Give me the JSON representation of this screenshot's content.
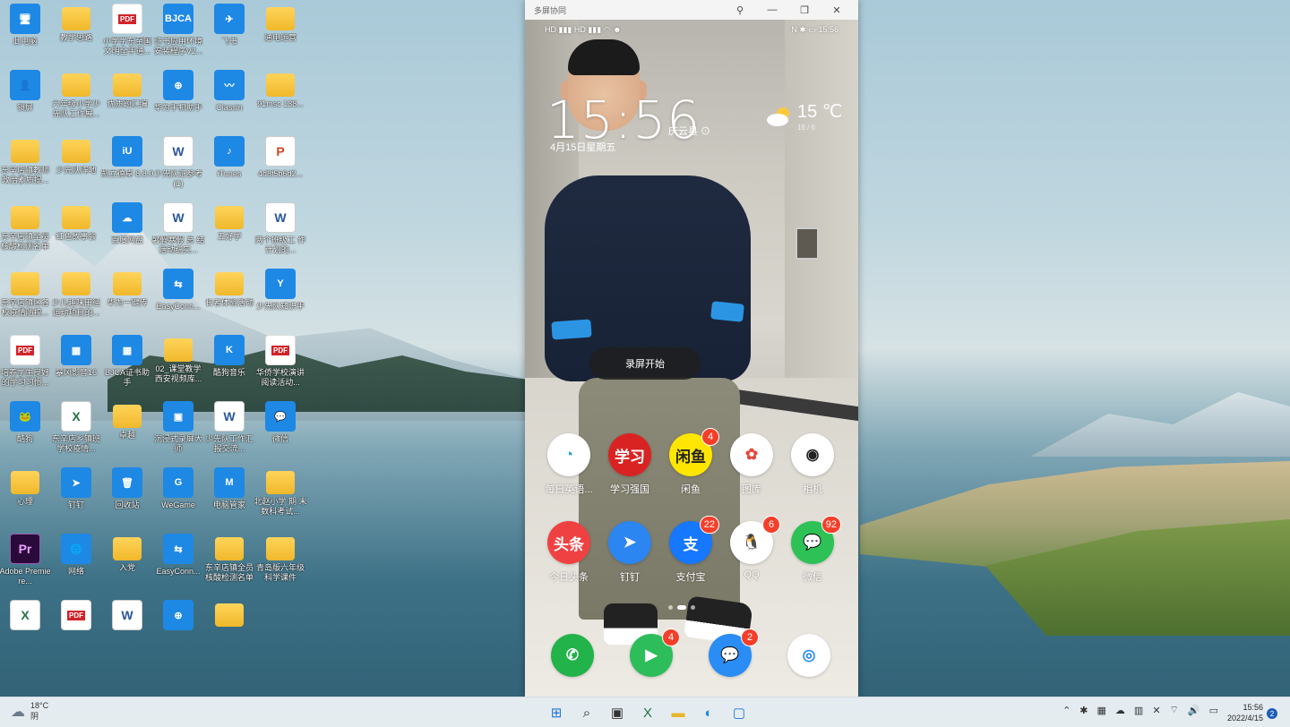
{
  "desktop": {
    "icons": [
      {
        "label": "此电脑",
        "glyph": "🖥"
      },
      {
        "label": "教学思路",
        "glyph": ""
      },
      {
        "label": "小学学东至国 文明全手通...",
        "glyph": "PDF"
      },
      {
        "label": "证书应用环境 安装程序V2...",
        "glyph": "BJCA"
      },
      {
        "label": "飞书",
        "glyph": "✈"
      },
      {
        "label": "通电运营",
        "glyph": ""
      },
      {
        "label": "锁屏",
        "glyph": "👤"
      },
      {
        "label": "六年级小学少 先队工作展...",
        "glyph": ""
      },
      {
        "label": "优质题汇编",
        "glyph": ""
      },
      {
        "label": "华为手机助手",
        "glyph": "⊕"
      },
      {
        "label": "Classin",
        "glyph": "〰"
      },
      {
        "label": "91msc 138...",
        "glyph": ""
      },
      {
        "label": "东辛店镇教师 政治素质提...",
        "glyph": ""
      },
      {
        "label": "少先队阵地",
        "glyph": ""
      },
      {
        "label": "凯立德卓 8.8.0",
        "glyph": "iU"
      },
      {
        "label": "少先队证参考 (1)",
        "glyph": "W"
      },
      {
        "label": "iTunes",
        "glyph": "♪"
      },
      {
        "label": "4d8f5b6d2...",
        "glyph": "P"
      },
      {
        "label": "东辛店镇全员 核酸检测名单",
        "glyph": ""
      },
      {
        "label": "红色故事会",
        "glyph": ""
      },
      {
        "label": "百度网盘",
        "glyph": "☁"
      },
      {
        "label": "暑假寒假 总 结活动纪实...",
        "glyph": "W"
      },
      {
        "label": "五好学",
        "glyph": ""
      },
      {
        "label": "两个班级工 作计划的...",
        "glyph": "W"
      },
      {
        "label": "东辛店镇区各 校疫情防控...",
        "glyph": ""
      },
      {
        "label": "少儿趣味田径 运动项目的...",
        "glyph": ""
      },
      {
        "label": "华为一键传",
        "glyph": ""
      },
      {
        "label": "EasyConn...",
        "glyph": "⇆"
      },
      {
        "label": "长者体验活动",
        "glyph": ""
      },
      {
        "label": "少先队知识手",
        "glyph": "Y"
      },
      {
        "label": "培养学生良好 的学习习惯...",
        "glyph": "PDF"
      },
      {
        "label": "暴风影音16",
        "glyph": "▦"
      },
      {
        "label": "BJCA证书助 手",
        "glyph": "▦"
      },
      {
        "label": "02_课堂教学 西安视频库...",
        "glyph": ""
      },
      {
        "label": "酷狗音乐",
        "glyph": "K"
      },
      {
        "label": "华侨学校演讲 阅读活动...",
        "glyph": "PDF"
      },
      {
        "label": "酷狗",
        "glyph": "🐸"
      },
      {
        "label": "东辛店乡镇班 学校疫情...",
        "glyph": "X"
      },
      {
        "label": "卓越",
        "glyph": ""
      },
      {
        "label": "沉浸式录屏大 师",
        "glyph": "▣"
      },
      {
        "label": "少先队工作汇 报交流...",
        "glyph": "W"
      },
      {
        "label": "微信",
        "glyph": "💬"
      },
      {
        "label": "心理",
        "glyph": ""
      },
      {
        "label": "钉钉",
        "glyph": "➤"
      },
      {
        "label": "回收站",
        "glyph": "🗑"
      },
      {
        "label": "WeGame",
        "glyph": "G"
      },
      {
        "label": "电脑管家",
        "glyph": "M"
      },
      {
        "label": "北赵小学 期 末数科考试...",
        "glyph": ""
      },
      {
        "label": "Adobe Premiere...",
        "glyph": "Pr"
      },
      {
        "label": "网络",
        "glyph": "🌐"
      },
      {
        "label": "入党",
        "glyph": ""
      },
      {
        "label": "EasyConn...",
        "glyph": "⇆"
      },
      {
        "label": "东辛店镇全员 核酸检测名单",
        "glyph": ""
      },
      {
        "label": "青岛版六年级 科学课件",
        "glyph": ""
      },
      {
        "label": "",
        "glyph": "X"
      },
      {
        "label": "",
        "glyph": "PDF"
      },
      {
        "label": "",
        "glyph": "W"
      },
      {
        "label": "",
        "glyph": "⊕"
      },
      {
        "label": "",
        "glyph": ""
      }
    ]
  },
  "phone_window": {
    "title": "多屏协同",
    "controls": {
      "pin": "⚲",
      "minimize": "—",
      "restore": "❐",
      "close": "✕"
    },
    "status": {
      "left": "HD ▮▮▮ HD ▮▮▮ ◠ ☻",
      "right": "N ✱ ▭ 15:56"
    },
    "clock": "15:56",
    "location": "庆云县 ⊙",
    "date": "4月15日星期五",
    "weather": {
      "temp": "15 ℃",
      "range": "16 / 6"
    },
    "toast": "录屏开始",
    "apps": [
      {
        "label": "每日英语...",
        "glyph": "◔",
        "bg": "#ffffff",
        "fg": "#2b9de0",
        "badge": ""
      },
      {
        "label": "学习强国",
        "glyph": "学习",
        "bg": "#d92323",
        "fg": "#ffffff",
        "badge": ""
      },
      {
        "label": "闲鱼",
        "glyph": "闲鱼",
        "bg": "#ffe600",
        "fg": "#222222",
        "badge": "4"
      },
      {
        "label": "图库",
        "glyph": "✿",
        "bg": "#ffffff",
        "fg": "#e4473c",
        "badge": ""
      },
      {
        "label": "相机",
        "glyph": "◉",
        "bg": "#ffffff",
        "fg": "#222222",
        "badge": ""
      },
      {
        "label": "今日头条",
        "glyph": "头条",
        "bg": "#f04142",
        "fg": "#ffffff",
        "badge": ""
      },
      {
        "label": "钉钉",
        "glyph": "➤",
        "bg": "#2b86f2",
        "fg": "#ffffff",
        "badge": ""
      },
      {
        "label": "支付宝",
        "glyph": "支",
        "bg": "#1677ff",
        "fg": "#ffffff",
        "badge": "22"
      },
      {
        "label": "QQ",
        "glyph": "🐧",
        "bg": "#ffffff",
        "fg": "#111111",
        "badge": "6"
      },
      {
        "label": "微信",
        "glyph": "💬",
        "bg": "#2dc156",
        "fg": "#ffffff",
        "badge": "92"
      }
    ],
    "dock": [
      {
        "glyph": "✆",
        "bg": "#22b34a",
        "badge": ""
      },
      {
        "glyph": "▶",
        "bg": "#2dbd5b",
        "badge": "4"
      },
      {
        "glyph": "💬",
        "bg": "#2a8cf5",
        "badge": "2"
      },
      {
        "glyph": "◎",
        "bg": "#ffffff",
        "badge": ""
      }
    ]
  },
  "taskbar": {
    "weather_temp": "18°C",
    "weather_desc": "阴",
    "apps": [
      {
        "name": "start-button",
        "glyph": "⊞",
        "color": "#1e73d8"
      },
      {
        "name": "search-button",
        "glyph": "⌕",
        "color": "#222222"
      },
      {
        "name": "task-view-button",
        "glyph": "▣",
        "color": "#333333"
      },
      {
        "name": "excel-button",
        "glyph": "X",
        "color": "#217346"
      },
      {
        "name": "file-explorer-button",
        "glyph": "▬",
        "color": "#e8b62a"
      },
      {
        "name": "edge-button",
        "glyph": "◐",
        "color": "#1b8bd6"
      },
      {
        "name": "phone-link-button",
        "glyph": "▢",
        "color": "#1e73d8"
      }
    ],
    "tray_icons": [
      "⌃",
      "✱",
      "▦",
      "☁",
      "▥",
      "✕",
      "⌔",
      "🔊",
      "▭"
    ],
    "time": "15:56",
    "date": "2022/4/15",
    "notification_count": "2"
  }
}
